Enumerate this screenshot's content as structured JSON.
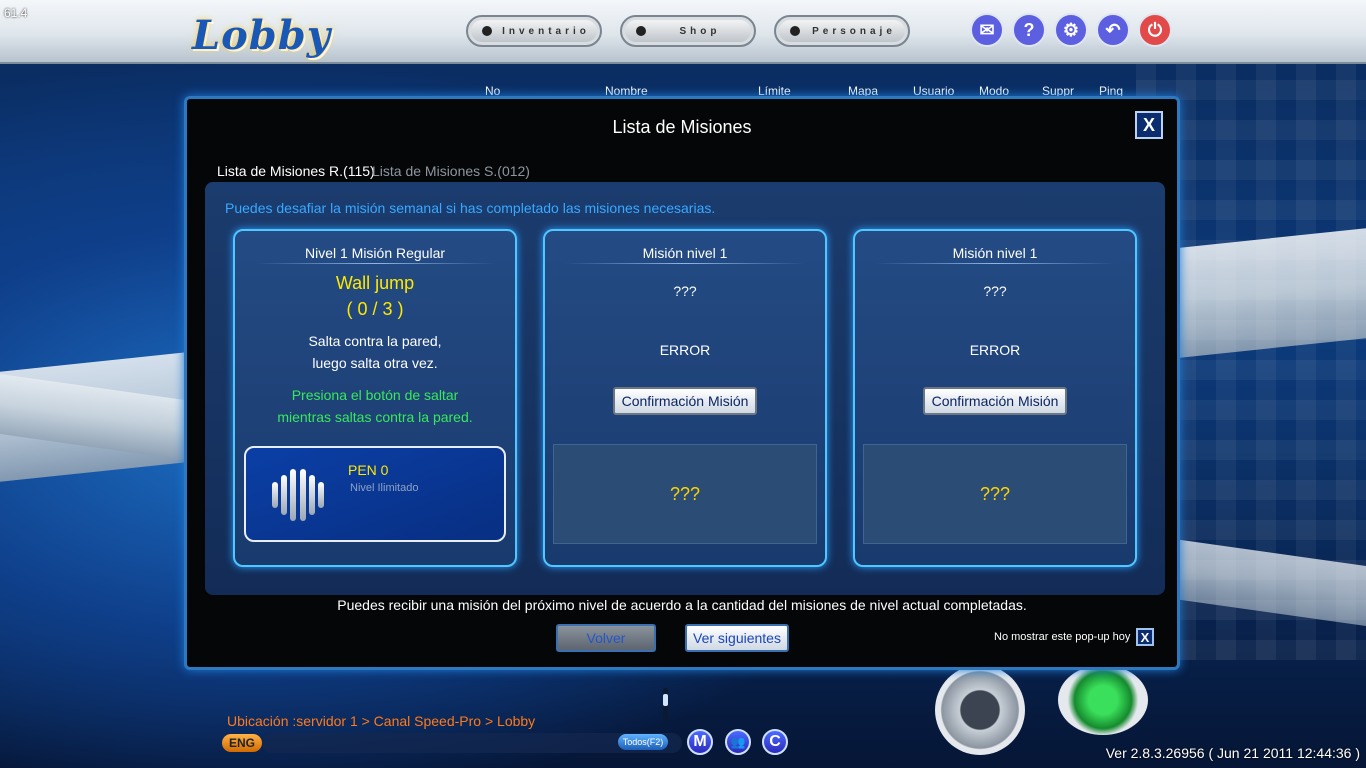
{
  "fps": "61.4",
  "logo": "Lobby",
  "top_nav": {
    "buttons": [
      "Inventario",
      "Shop",
      "Personaje"
    ],
    "icons": [
      {
        "name": "mail-icon",
        "glyph": "✉",
        "color": "#5b5fe0"
      },
      {
        "name": "help-icon",
        "glyph": "?",
        "color": "#5b5fe0"
      },
      {
        "name": "settings-icon",
        "glyph": "⚙",
        "color": "#5b5fe0"
      },
      {
        "name": "back-icon",
        "glyph": "↶",
        "color": "#5b5fe0"
      },
      {
        "name": "power-icon",
        "glyph": "⏻",
        "color": "#e24a4a"
      }
    ]
  },
  "room_list_headers": [
    "No",
    "Nombre",
    "Límite",
    "Mapa",
    "Usuario",
    "Modo",
    "Suppr",
    "Ping"
  ],
  "dialog": {
    "title": "Lista de Misiones",
    "tabs": [
      "Lista de Misiones R.(115)",
      "Lista de Misiones S.(012)"
    ],
    "notice": "Puedes desafiar la misión semanal si has completado las misiones necesarias.",
    "card1": {
      "title": "Nivel 1  Misión Regular",
      "mission_name": "Wall jump",
      "progress": "( 0 / 3 )",
      "desc_line1": "Salta contra la pared,",
      "desc_line2": "luego salta otra vez.",
      "hint_line1": "Presiona el botón de saltar",
      "hint_line2": "mientras saltas contra la pared.",
      "reward_name": "PEN 0",
      "reward_sub": "Nivel Ilimitado"
    },
    "card2": {
      "title": "Misión nivel 1",
      "unknown": "???",
      "status": "ERROR",
      "button": "Confirmación Misión",
      "reward": "???"
    },
    "card3": {
      "title": "Misión nivel 1",
      "unknown": "???",
      "status": "ERROR",
      "button": "Confirmación Misión",
      "reward": "???"
    },
    "footer": "Puedes recibir una misión del próximo nivel de acuerdo a la cantidad del misiones de nivel actual completadas.",
    "back_button": "Volver",
    "next_button": "Ver siguientes",
    "no_show": "No mostrar este pop-up hoy",
    "close_glyph": "X"
  },
  "bottom": {
    "location": "Ubicación :servidor 1 > Canal Speed-Pro > Lobby",
    "lang": "ENG",
    "chat_filter": "Todos(F2)",
    "round_buttons": [
      "M",
      "👥",
      "C"
    ],
    "version": "Ver 2.8.3.26956 ( Jun 21 2011 12:44:36 )"
  }
}
